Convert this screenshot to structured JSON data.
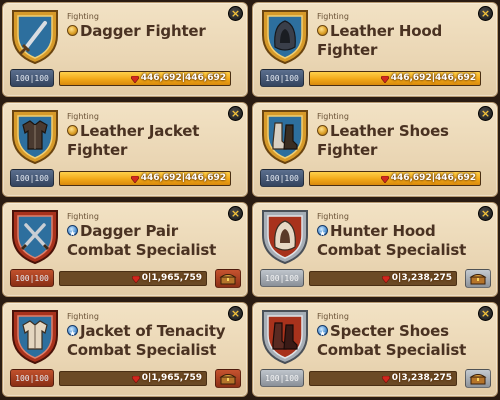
{
  "colors": {
    "accent_gold": "#f2a818",
    "card_bg": "#ecd9b8",
    "crest_gold": "#d69a2a",
    "crest_red": "#a8321c",
    "crest_silver": "#a7aeb6",
    "text_brown": "#4a3222",
    "gem_red": "#d2281e"
  },
  "cards": [
    {
      "category": "Fighting",
      "title": "Dagger Fighter",
      "rank_icon": "gold-rank-icon",
      "crest": "gold-shield-dagger-icon",
      "level_text": "100|100",
      "progress_text": "446,692|446,692",
      "progress": 1.0,
      "close_label": "×"
    },
    {
      "category": "Fighting",
      "title": "Leather Hood Fighter",
      "rank_icon": "gold-rank-icon",
      "crest": "gold-shield-hood-icon",
      "level_text": "100|100",
      "progress_text": "446,692|446,692",
      "progress": 1.0,
      "close_label": "×"
    },
    {
      "category": "Fighting",
      "title": "Leather Jacket Fighter",
      "rank_icon": "gold-rank-icon",
      "crest": "gold-shield-jacket-icon",
      "level_text": "100|100",
      "progress_text": "446,692|446,692",
      "progress": 1.0,
      "close_label": "×"
    },
    {
      "category": "Fighting",
      "title": "Leather Shoes Fighter",
      "rank_icon": "gold-rank-icon",
      "crest": "gold-shield-shoes-icon",
      "level_text": "100|100",
      "progress_text": "446,692|446,692",
      "progress": 1.0,
      "close_label": "×"
    },
    {
      "category": "Fighting",
      "title": "Dagger Pair Combat Specialist",
      "rank_icon": "blue-star-rank-icon",
      "crest": "red-shield-dagger-pair-icon",
      "level_text": "100|100",
      "progress_text": "0|1,965,759",
      "progress": 0.0,
      "close_label": "×",
      "reward_icon": "treasure-chest-icon"
    },
    {
      "category": "Fighting",
      "title": "Hunter Hood Combat Specialist",
      "rank_icon": "blue-star-rank-icon",
      "crest": "silver-shield-hood-icon",
      "level_text": "100|100",
      "progress_text": "0|3,238,275",
      "progress": 0.0,
      "close_label": "×",
      "reward_icon": "treasure-chest-icon"
    },
    {
      "category": "Fighting",
      "title": "Jacket of Tenacity Combat Specialist",
      "rank_icon": "blue-star-rank-icon",
      "crest": "red-shield-jacket-icon",
      "level_text": "100|100",
      "progress_text": "0|1,965,759",
      "progress": 0.0,
      "close_label": "×",
      "reward_icon": "treasure-chest-icon"
    },
    {
      "category": "Fighting",
      "title": "Specter Shoes Combat Specialist",
      "rank_icon": "blue-star-rank-icon",
      "crest": "silver-shield-shoes-icon",
      "level_text": "100|100",
      "progress_text": "0|3,238,275",
      "progress": 0.0,
      "close_label": "×",
      "reward_icon": "treasure-chest-icon"
    }
  ]
}
